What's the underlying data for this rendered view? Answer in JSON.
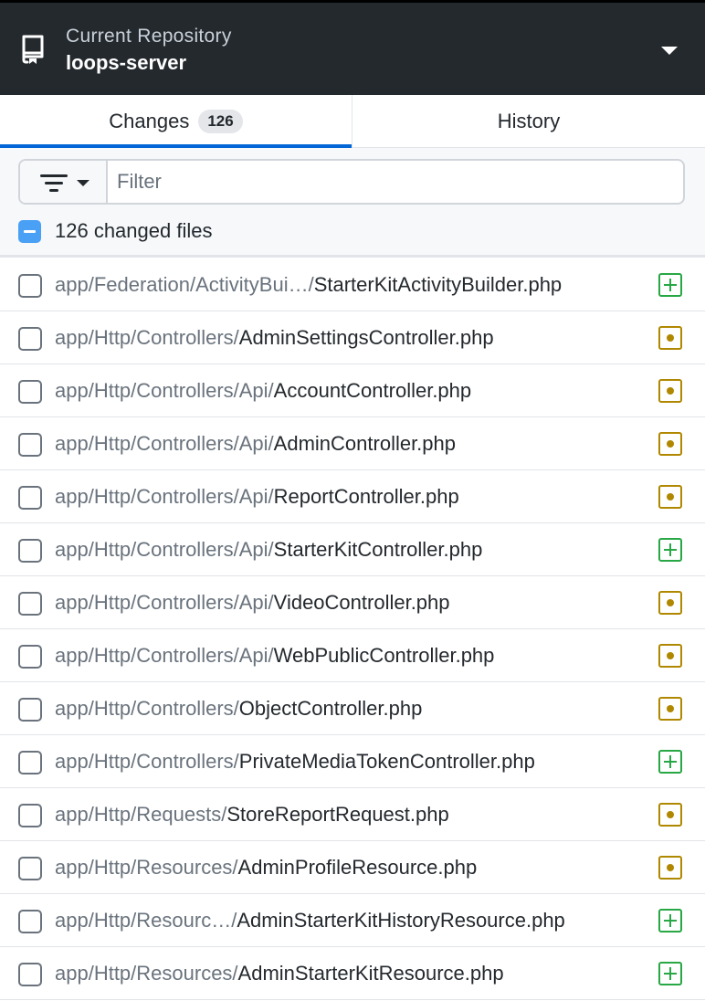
{
  "header": {
    "caption": "Current Repository",
    "repo_name": "loops-server"
  },
  "tabs": {
    "changes": {
      "label": "Changes",
      "count": "126"
    },
    "history": {
      "label": "History"
    }
  },
  "filter": {
    "placeholder": "Filter",
    "value": ""
  },
  "select_all": {
    "label": "126 changed files"
  },
  "status_colors": {
    "modified": "#b08800",
    "added": "#28a745"
  },
  "files": [
    {
      "dir": "app/Federation/ActivityBui…/",
      "name": "StarterKitActivityBuilder.php",
      "status": "added"
    },
    {
      "dir": "app/Http/Controllers/",
      "name": "AdminSettingsController.php",
      "status": "modified"
    },
    {
      "dir": "app/Http/Controllers/Api/",
      "name": "AccountController.php",
      "status": "modified"
    },
    {
      "dir": "app/Http/Controllers/Api/",
      "name": "AdminController.php",
      "status": "modified"
    },
    {
      "dir": "app/Http/Controllers/Api/",
      "name": "ReportController.php",
      "status": "modified"
    },
    {
      "dir": "app/Http/Controllers/Api/",
      "name": "StarterKitController.php",
      "status": "added"
    },
    {
      "dir": "app/Http/Controllers/Api/",
      "name": "VideoController.php",
      "status": "modified"
    },
    {
      "dir": "app/Http/Controllers/Api/",
      "name": "WebPublicController.php",
      "status": "modified"
    },
    {
      "dir": "app/Http/Controllers/",
      "name": "ObjectController.php",
      "status": "modified"
    },
    {
      "dir": "app/Http/Controllers/",
      "name": "PrivateMediaTokenController.php",
      "status": "added"
    },
    {
      "dir": "app/Http/Requests/",
      "name": "StoreReportRequest.php",
      "status": "modified"
    },
    {
      "dir": "app/Http/Resources/",
      "name": "AdminProfileResource.php",
      "status": "modified"
    },
    {
      "dir": "app/Http/Resourc…/",
      "name": "AdminStarterKitHistoryResource.php",
      "status": "added"
    },
    {
      "dir": "app/Http/Resources/",
      "name": "AdminStarterKitResource.php",
      "status": "added"
    }
  ]
}
